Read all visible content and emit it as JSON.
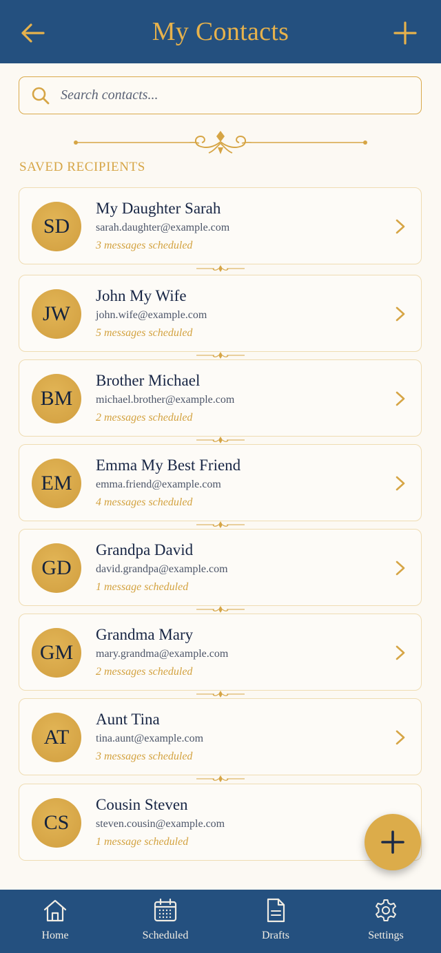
{
  "header": {
    "title": "My Contacts",
    "back_icon": "arrow-left-icon",
    "add_icon": "plus-icon"
  },
  "search": {
    "placeholder": "Search contacts...",
    "value": ""
  },
  "section": {
    "label": "SAVED RECIPIENTS"
  },
  "contacts": [
    {
      "initials": "SD",
      "name": "My Daughter Sarah",
      "email": "sarah.daughter@example.com",
      "status": "3 messages scheduled"
    },
    {
      "initials": "JW",
      "name": "John My Wife",
      "email": "john.wife@example.com",
      "status": "5 messages scheduled"
    },
    {
      "initials": "BM",
      "name": "Brother Michael",
      "email": "michael.brother@example.com",
      "status": "2 messages scheduled"
    },
    {
      "initials": "EM",
      "name": "Emma My Best Friend",
      "email": "emma.friend@example.com",
      "status": "4 messages scheduled"
    },
    {
      "initials": "GD",
      "name": "Grandpa David",
      "email": "david.grandpa@example.com",
      "status": "1 message scheduled"
    },
    {
      "initials": "GM",
      "name": "Grandma Mary",
      "email": "mary.grandma@example.com",
      "status": "2 messages scheduled"
    },
    {
      "initials": "AT",
      "name": "Aunt Tina",
      "email": "tina.aunt@example.com",
      "status": "3 messages scheduled"
    },
    {
      "initials": "CS",
      "name": "Cousin Steven",
      "email": "steven.cousin@example.com",
      "status": "1 message scheduled"
    }
  ],
  "fab": {
    "icon": "plus-icon"
  },
  "nav": [
    {
      "label": "Home",
      "icon": "home-icon"
    },
    {
      "label": "Scheduled",
      "icon": "calendar-icon"
    },
    {
      "label": "Drafts",
      "icon": "document-icon"
    },
    {
      "label": "Settings",
      "icon": "gear-icon"
    }
  ],
  "colors": {
    "primary": "#24507f",
    "gold": "#dcac4a",
    "background": "#fcf9f3",
    "text": "#172544"
  }
}
